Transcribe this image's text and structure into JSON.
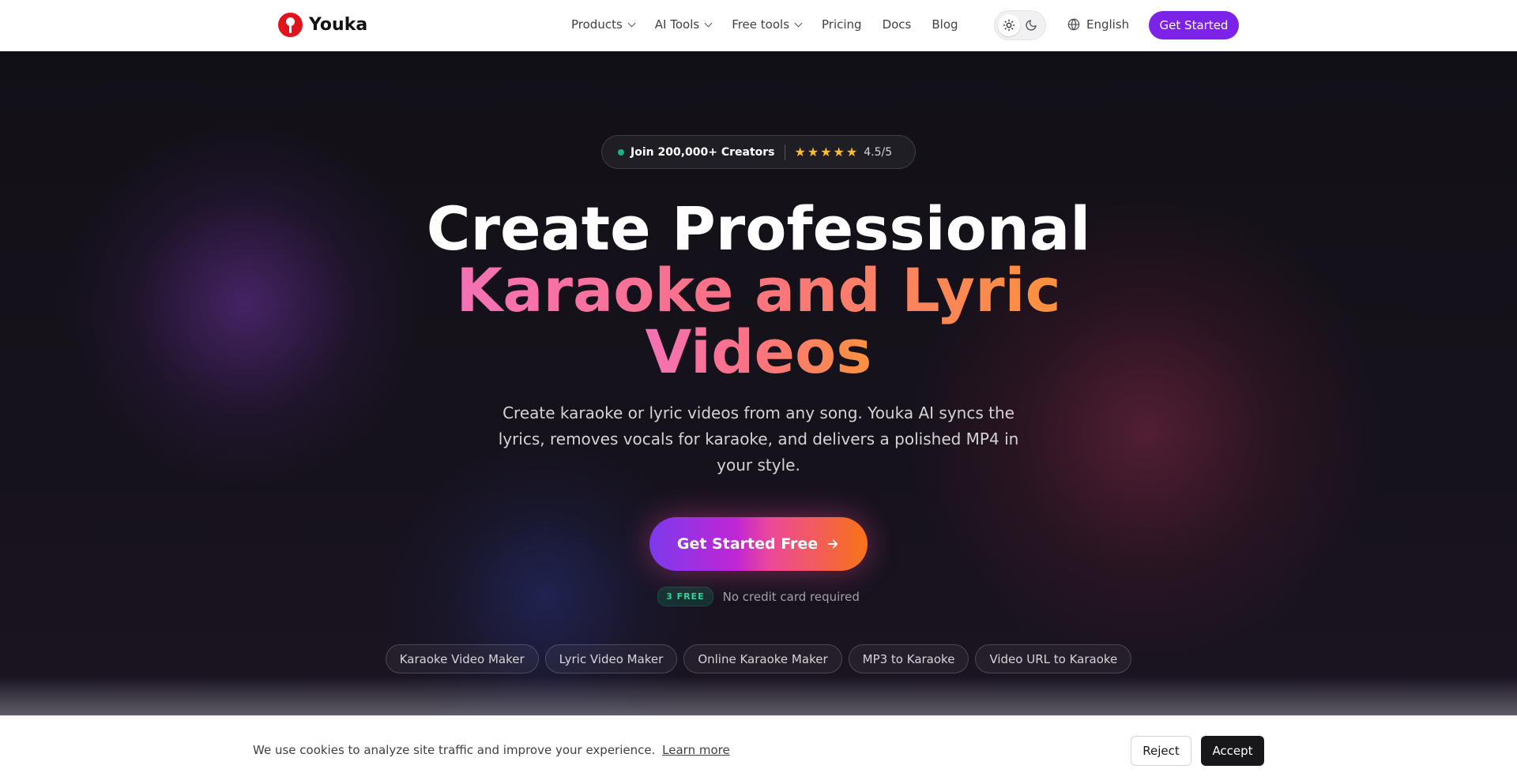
{
  "header": {
    "logo_text": "Youka",
    "nav": [
      {
        "label": "Products",
        "dropdown": true
      },
      {
        "label": "AI Tools",
        "dropdown": true
      },
      {
        "label": "Free tools",
        "dropdown": true
      },
      {
        "label": "Pricing",
        "dropdown": false
      },
      {
        "label": "Docs",
        "dropdown": false
      },
      {
        "label": "Blog",
        "dropdown": false
      }
    ],
    "theme_active": "light",
    "language": "English",
    "cta": "Get Started",
    "cta_color": "#7c22e9"
  },
  "hero": {
    "badge_text": "Join 200,000+ Creators",
    "stars": 5,
    "rating": "4.5/5",
    "title_line1": "Create Professional",
    "title_line2": "Karaoke and Lyric",
    "title_line3": "Videos",
    "subtitle": "Create karaoke or lyric videos from any song. Youka AI syncs the lyrics, removes vocals for karaoke, and delivers a polished MP4 in your style.",
    "cta": "Get Started Free",
    "free_badge": "3 FREE",
    "free_note": "No credit card required",
    "chips": [
      "Karaoke Video Maker",
      "Lyric Video Maker",
      "Online Karaoke Maker",
      "MP3 to Karaoke",
      "Video URL to Karaoke"
    ]
  },
  "cookie": {
    "text": "We use cookies to analyze site traffic and improve your experience.",
    "link": "Learn more",
    "reject": "Reject",
    "accept": "Accept"
  }
}
